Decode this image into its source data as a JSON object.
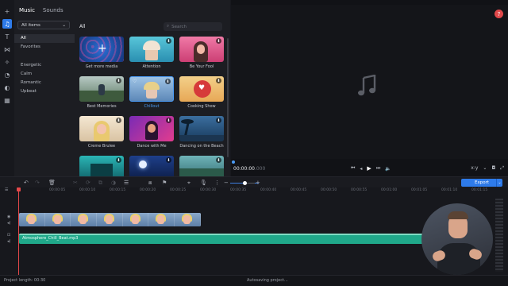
{
  "colors": {
    "accent": "#2e7bea",
    "playhead": "#e5484a",
    "audio_clip": "#20a88a",
    "help": "#e0484a"
  },
  "library": {
    "tabs": [
      {
        "label": "Music"
      },
      {
        "label": "Sounds"
      }
    ],
    "dropdown_value": "All items",
    "categories": [
      "All",
      "Favorites",
      "Energetic",
      "Calm",
      "Romantic",
      "Upbeat"
    ],
    "grid_title": "All",
    "search_placeholder": "Search",
    "items": [
      {
        "label": "Get more media",
        "icon": "plus-icon"
      },
      {
        "label": "Attention"
      },
      {
        "label": "Be Your Fool"
      },
      {
        "label": "Best Memories"
      },
      {
        "label": "Chillout"
      },
      {
        "label": "Cooking Show"
      },
      {
        "label": "Creme Brulee"
      },
      {
        "label": "Dance with Me"
      },
      {
        "label": "Dancing on the Beach"
      },
      {
        "label": ""
      },
      {
        "label": ""
      },
      {
        "label": ""
      }
    ]
  },
  "player": {
    "timecode": "00:00:00",
    "timecode_frames": ".000",
    "aspect": "x:y",
    "help": "?"
  },
  "timeline": {
    "export_label": "Export",
    "ruler": [
      "00:00:00",
      "00:00:05",
      "00:00:10",
      "00:00:15",
      "00:00:20",
      "00:00:25",
      "00:00:30",
      "00:00:35",
      "00:00:40",
      "00:00:45",
      "00:00:50",
      "00:00:55",
      "00:01:00",
      "00:01:05",
      "00:01:10",
      "00:01:15"
    ],
    "audio_clip_label": "Atmosphere_Chill_Beat.mp3"
  },
  "status": {
    "project_length": "Project length: 00:30",
    "autosave": "Autosaving project..."
  }
}
